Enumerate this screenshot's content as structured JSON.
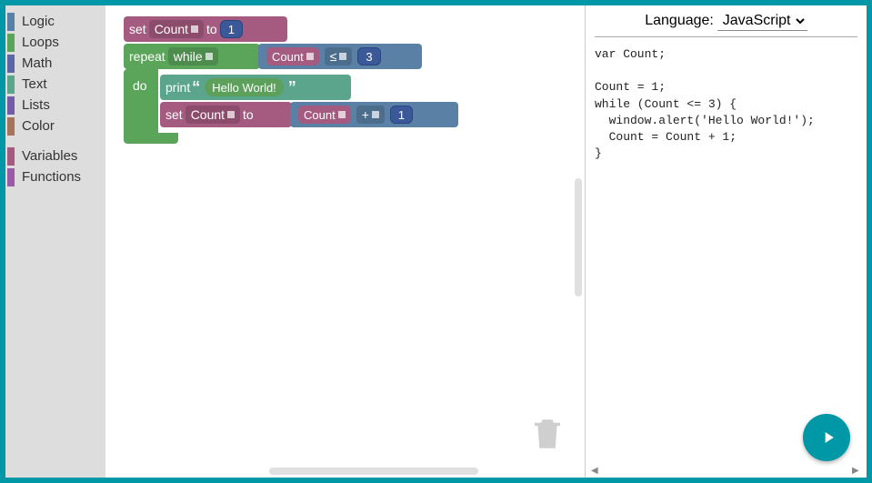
{
  "toolbox": {
    "categories": [
      {
        "name": "Logic",
        "color": "#5b80a5"
      },
      {
        "name": "Loops",
        "color": "#5ba55b"
      },
      {
        "name": "Math",
        "color": "#5b67a5"
      },
      {
        "name": "Text",
        "color": "#5ba58c"
      },
      {
        "name": "Lists",
        "color": "#745ba5"
      },
      {
        "name": "Color",
        "color": "#a5745b"
      }
    ],
    "categories2": [
      {
        "name": "Variables",
        "color": "#a55b80"
      },
      {
        "name": "Functions",
        "color": "#995ba5"
      }
    ]
  },
  "blocks": {
    "set1": {
      "set": "set",
      "var": "Count",
      "to": "to",
      "val": "1"
    },
    "repeat": {
      "repeat": "repeat",
      "mode": "while",
      "do": "do"
    },
    "cond": {
      "var": "Count",
      "op": "≤",
      "val": "3"
    },
    "print": {
      "print": "print",
      "text": "Hello World!"
    },
    "set2": {
      "set": "set",
      "var": "Count",
      "to": "to"
    },
    "incr": {
      "var": "Count",
      "op": "+",
      "val": "1"
    }
  },
  "code": {
    "language_label": "Language:",
    "language": "JavaScript",
    "source": "var Count;\n\nCount = 1;\nwhile (Count <= 3) {\n  window.alert('Hello World!');\n  Count = Count + 1;\n}"
  }
}
